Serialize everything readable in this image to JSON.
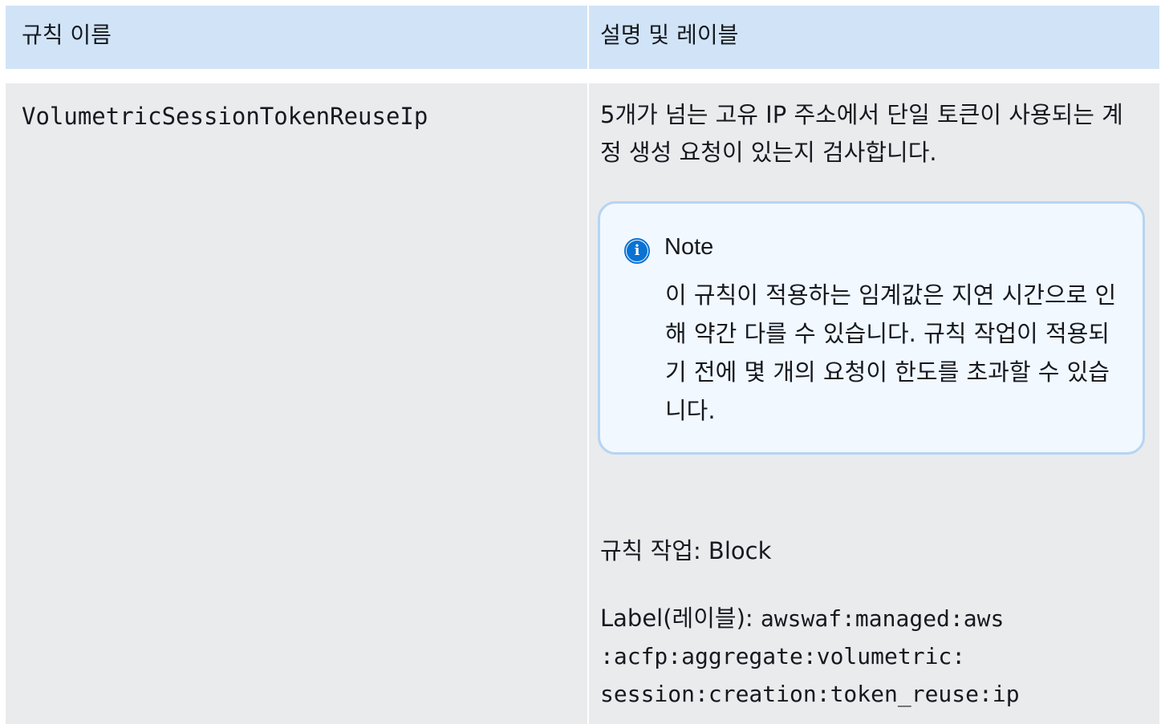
{
  "table": {
    "headers": {
      "rule_name": "규칙 이름",
      "description": "설명 및 레이블"
    },
    "rows": [
      {
        "rule_name": "VolumetricSessionTokenReuseIp",
        "description": "5개가 넘는 고유 IP 주소에서 단일 토큰이 사용되는 계정 생성 요청이 있는지 검사합니다.",
        "note": {
          "icon": "info-icon",
          "title": "Note",
          "text": "이 규칙이 적용하는 임계값은 지연 시간으로 인해 약간 다를 수 있습니다. 규칙 작업이 적용되기 전에 몇 개의 요청이 한도를 초과할 수 있습니다."
        },
        "rule_action": "규칙 작업: Block",
        "label_prefix": "Label(레이블): ",
        "label_value_line1": "awswaf:managed:aws",
        "label_value_line2": ":acfp:aggregate:volumetric:",
        "label_value_line3": "session:creation:token_reuse:ip"
      }
    ]
  },
  "colors": {
    "header_bg": "#d1e4f7",
    "body_bg": "#e9ebed",
    "note_bg": "#f1f8ff",
    "note_border": "#b6d4f2",
    "info_icon": "#0972d3"
  }
}
